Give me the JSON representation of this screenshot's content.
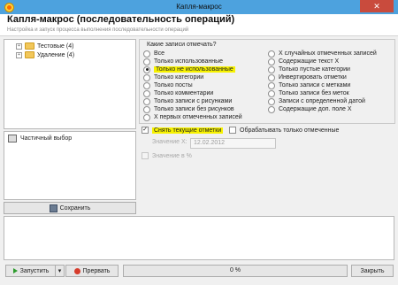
{
  "window": {
    "title": "Капля-макрос",
    "close_glyph": "✕"
  },
  "header": {
    "title": "Капля-макрос (последовательность операций)",
    "subtitle": "Настройка и запуск процесса выполнения последовательности операций"
  },
  "tree": {
    "items": [
      {
        "expander": "+",
        "label": "Тестовые (4)"
      },
      {
        "expander": "+",
        "label": "Удаление (4)"
      }
    ]
  },
  "records_group": {
    "title": "Какие записи отмечать?",
    "left_options": [
      "Все",
      "Только использованные",
      "Только не использованные",
      "Только категории",
      "Только посты",
      "Только комментарии",
      "Только записи с рисунками",
      "Только записи без рисунков",
      "X первых отмеченных записей"
    ],
    "right_options": [
      "X случайных отмеченных записей",
      "Содержащие текст X",
      "Только пустые категории",
      "Инвертировать отметки",
      "Только записи с метками",
      "Только записи без меток",
      "Записи с определенной датой",
      "Содержащие доп. поле X"
    ],
    "selected_left_index": 2
  },
  "options": {
    "uncheck_current": {
      "label": "Снять текущие отметки",
      "checked": true,
      "mark": "✓"
    },
    "process_only_marked": {
      "label": "Обрабатывать только отмеченные",
      "checked": false
    },
    "value_x_label": "Значение X:",
    "value_x": "12.02.2012",
    "value_in_percent_label": "Значение в %"
  },
  "partial": {
    "label": "Частичный выбор"
  },
  "buttons": {
    "save": "Сохранить",
    "run": "Запустить",
    "run_dropdown": "▾",
    "stop": "Прервать",
    "close": "Закрыть"
  },
  "progress": {
    "text": "0 %",
    "value": 0
  },
  "colors": {
    "titlebar": "#4da2de",
    "highlight": "#f7f200",
    "close": "#c94b3d"
  }
}
